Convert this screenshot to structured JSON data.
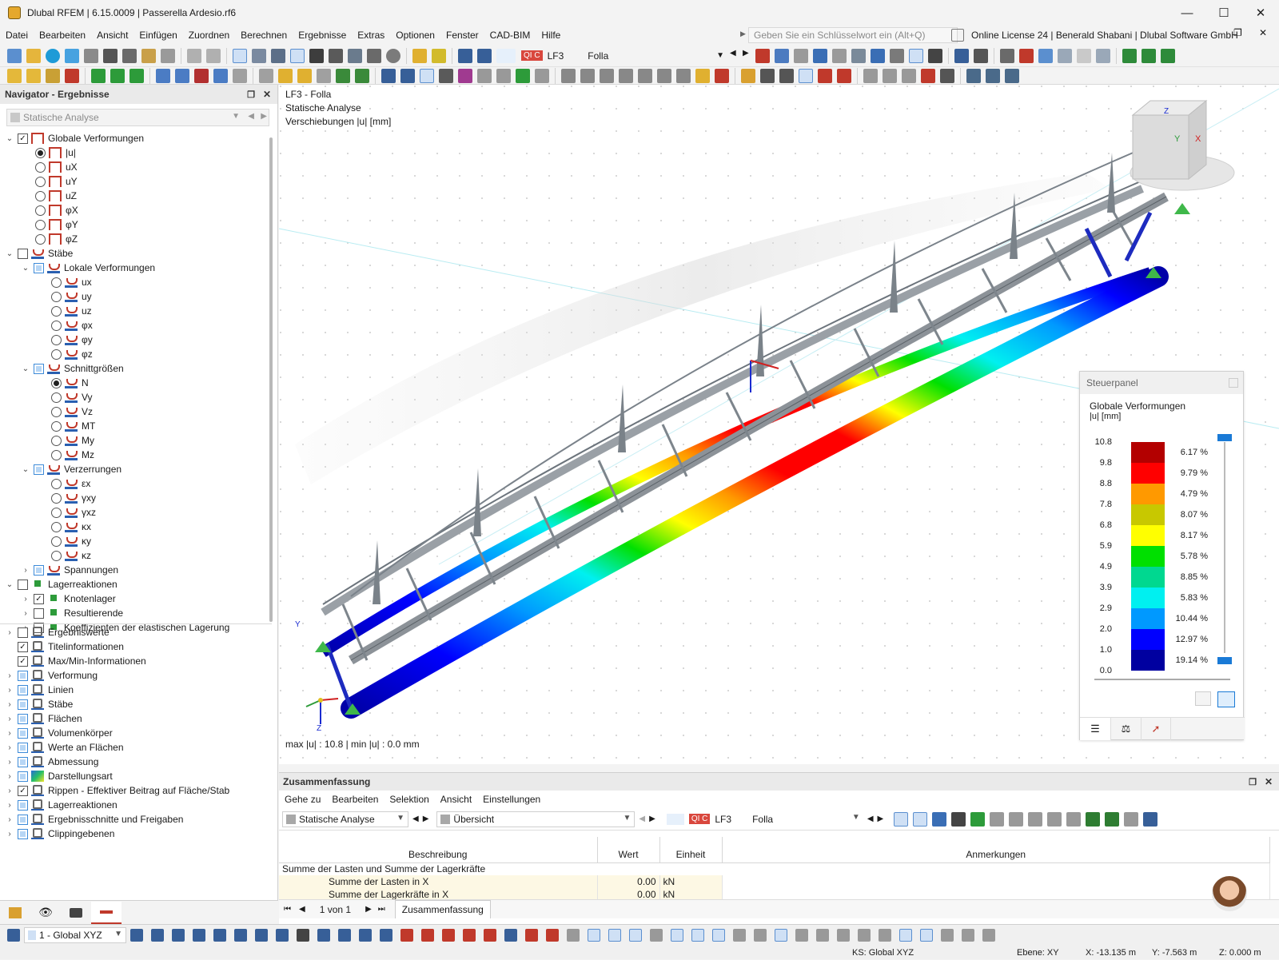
{
  "window": {
    "title": "Dlubal RFEM | 6.15.0009 | Passerella Ardesio.rf6"
  },
  "menu": [
    "Datei",
    "Bearbeiten",
    "Ansicht",
    "Einfügen",
    "Zuordnen",
    "Berechnen",
    "Ergebnisse",
    "Extras",
    "Optionen",
    "Fenster",
    "CAD-BIM",
    "Hilfe"
  ],
  "search": {
    "placeholder": "Geben Sie ein Schlüsselwort ein (Alt+Q)"
  },
  "license": "Online License 24 | Benerald Shabani | Dlubal Software GmbH",
  "loadcase": {
    "badge": "QI C",
    "code": "LF3",
    "name": "Folla"
  },
  "navigator": {
    "title": "Navigator - Ergebnisse",
    "select": "Statische Analyse",
    "items": [
      {
        "label": "Globale Verformungen",
        "level": 0
      },
      {
        "label": "|u|",
        "level": 1
      },
      {
        "label": "uX",
        "level": 1
      },
      {
        "label": "uY",
        "level": 1
      },
      {
        "label": "uZ",
        "level": 1
      },
      {
        "label": "φX",
        "level": 1
      },
      {
        "label": "φY",
        "level": 1
      },
      {
        "label": "φZ",
        "level": 1
      },
      {
        "label": "Stäbe",
        "level": 0
      },
      {
        "label": "Lokale Verformungen",
        "level": 1
      },
      {
        "label": "ux",
        "level": 2
      },
      {
        "label": "uy",
        "level": 2
      },
      {
        "label": "uz",
        "level": 2
      },
      {
        "label": "φx",
        "level": 2
      },
      {
        "label": "φy",
        "level": 2
      },
      {
        "label": "φz",
        "level": 2
      },
      {
        "label": "Schnittgrößen",
        "level": 1
      },
      {
        "label": "N",
        "level": 2
      },
      {
        "label": "Vy",
        "level": 2
      },
      {
        "label": "Vz",
        "level": 2
      },
      {
        "label": "MT",
        "level": 2
      },
      {
        "label": "My",
        "level": 2
      },
      {
        "label": "Mz",
        "level": 2
      },
      {
        "label": "Verzerrungen",
        "level": 1
      },
      {
        "label": "εx",
        "level": 2
      },
      {
        "label": "γxy",
        "level": 2
      },
      {
        "label": "γxz",
        "level": 2
      },
      {
        "label": "κx",
        "level": 2
      },
      {
        "label": "κy",
        "level": 2
      },
      {
        "label": "κz",
        "level": 2
      },
      {
        "label": "Spannungen",
        "level": 1
      },
      {
        "label": "Lagerreaktionen",
        "level": 0
      },
      {
        "label": "Knotenlager",
        "level": 1
      },
      {
        "label": "Resultierende",
        "level": 1
      },
      {
        "label": "Koeffizienten der elastischen Lagerung",
        "level": 1
      }
    ],
    "display_items": [
      "Ergebniswerte",
      "Titelinformationen",
      "Max/Min-Informationen",
      "Verformung",
      "Linien",
      "Stäbe",
      "Flächen",
      "Volumenkörper",
      "Werte an Flächen",
      "Abmessung",
      "Darstellungsart",
      "Rippen - Effektiver Beitrag auf Fläche/Stab",
      "Lagerreaktionen",
      "Ergebnisschnitte und Freigaben",
      "Clippingebenen"
    ]
  },
  "viewport": {
    "line1": "LF3 - Folla",
    "line2": "Statische Analyse",
    "line3": "Verschiebungen |u| [mm]",
    "maxmin": "max |u| : 10.8 | min |u| : 0.0 mm",
    "axis_x": "X",
    "axis_y": "Y",
    "axis_z": "Z"
  },
  "control_panel": {
    "title": "Steuerpanel",
    "heading": "Globale Verformungen",
    "unit": "|u| [mm]",
    "legend": [
      {
        "value": "10.8",
        "percent": "6.17 %",
        "color": "#b30000"
      },
      {
        "value": "9.8",
        "percent": "9.79 %",
        "color": "#ff0000"
      },
      {
        "value": "8.8",
        "percent": "4.79 %",
        "color": "#ff9900"
      },
      {
        "value": "7.8",
        "percent": "8.07 %",
        "color": "#c8c800"
      },
      {
        "value": "6.8",
        "percent": "8.17 %",
        "color": "#ffff00"
      },
      {
        "value": "5.9",
        "percent": "5.78 %",
        "color": "#00e000"
      },
      {
        "value": "4.9",
        "percent": "8.85 %",
        "color": "#00d890"
      },
      {
        "value": "3.9",
        "percent": "5.83 %",
        "color": "#00f0f0"
      },
      {
        "value": "2.9",
        "percent": "10.44 %",
        "color": "#0099ff"
      },
      {
        "value": "2.0",
        "percent": "12.97 %",
        "color": "#0000ff"
      },
      {
        "value": "1.0",
        "percent": "19.14 %",
        "color": "#0000a0"
      }
    ],
    "last_value": "0.0"
  },
  "summary": {
    "title": "Zusammenfassung",
    "menu": [
      "Gehe zu",
      "Bearbeiten",
      "Selektion",
      "Ansicht",
      "Einstellungen"
    ],
    "analysis": "Statische Analyse",
    "overview": "Übersicht",
    "columns": [
      "Beschreibung",
      "Wert",
      "Einheit",
      "Anmerkungen"
    ],
    "group": "Summe der Lasten und Summe der Lagerkräfte",
    "rows": [
      {
        "desc": "Summe der Lasten in X",
        "value": "0.00",
        "unit": "kN"
      },
      {
        "desc": "Summe der Lagerkräfte in X",
        "value": "0.00",
        "unit": "kN"
      }
    ],
    "pager": "1 von 1",
    "tab": "Zusammenfassung"
  },
  "statusbar": {
    "cs": "1 - Global XYZ",
    "ks": "KS: Global XYZ",
    "plane": "Ebene: XY",
    "x": "X: -13.135 m",
    "y": "Y: -7.563 m",
    "z": "Z: 0.000 m"
  }
}
